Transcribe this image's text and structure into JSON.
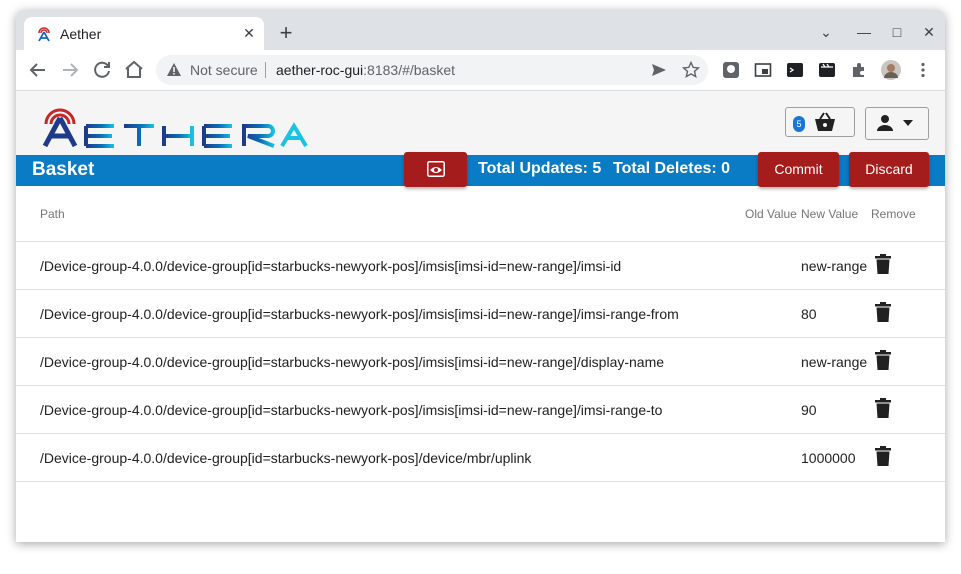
{
  "browser": {
    "tab_title": "Aether",
    "tab_close": "✕",
    "new_tab": "+",
    "security_label": "Not secure",
    "url_host": "aether-roc-gui",
    "url_rest": ":8183/#/basket",
    "window_controls": {
      "minimize": "—",
      "maximize": "□",
      "close": "✕",
      "tabsearch": "⌄"
    }
  },
  "app": {
    "basket_count": "5",
    "colors": {
      "accent_blue": "#0a7bc5",
      "button_red": "#a51c1c"
    }
  },
  "bar": {
    "title": "Basket",
    "total_updates": "Total Updates: 5",
    "total_deletes": "Total Deletes: 0",
    "commit_label": "Commit",
    "discard_label": "Discard"
  },
  "table": {
    "headers": {
      "path": "Path",
      "old_value": "Old Value",
      "new_value": "New Value",
      "remove": "Remove"
    },
    "rows": [
      {
        "path": "/Device-group-4.0.0/device-group[id=starbucks-newyork-pos]/imsis[imsi-id=new-range]/imsi-id",
        "new_value": "new-range"
      },
      {
        "path": "/Device-group-4.0.0/device-group[id=starbucks-newyork-pos]/imsis[imsi-id=new-range]/imsi-range-from",
        "new_value": "80"
      },
      {
        "path": "/Device-group-4.0.0/device-group[id=starbucks-newyork-pos]/imsis[imsi-id=new-range]/display-name",
        "new_value": "new-range"
      },
      {
        "path": "/Device-group-4.0.0/device-group[id=starbucks-newyork-pos]/imsis[imsi-id=new-range]/imsi-range-to",
        "new_value": "90"
      },
      {
        "path": "/Device-group-4.0.0/device-group[id=starbucks-newyork-pos]/device/mbr/uplink",
        "new_value": "1000000"
      }
    ]
  }
}
